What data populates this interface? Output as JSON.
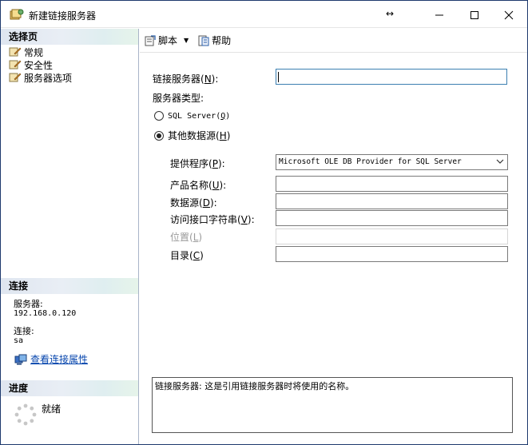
{
  "window": {
    "title": "新建链接服务器",
    "resize_glyph": "↔"
  },
  "left": {
    "select_page_header": "选择页",
    "pages": [
      {
        "label": "常规"
      },
      {
        "label": "安全性"
      },
      {
        "label": "服务器选项"
      }
    ],
    "connection_header": "连接",
    "server_label": "服务器:",
    "server_value": "192.168.0.120",
    "connection_label": "连接:",
    "connection_value": "sa",
    "view_props_link": "查看连接属性",
    "progress_header": "进度",
    "progress_status": "就绪"
  },
  "toolbar": {
    "script_label": "脚本",
    "help_label": "帮助"
  },
  "form": {
    "linked_server_label": "链接服务器(",
    "linked_server_key": "N",
    "linked_server_suffix": "):",
    "linked_server_value": "",
    "server_type_label": "服务器类型:",
    "sql_server_option": "SQL Server(",
    "sql_server_key": "Q",
    "sql_server_suffix": ")",
    "other_source_option": "其他数据源(",
    "other_source_key": "H",
    "other_source_suffix": ")",
    "selected_type": "other",
    "provider_label": "提供程序(",
    "provider_key": "P",
    "provider_suffix": "):",
    "provider_value": "Microsoft OLE DB Provider for SQL Server",
    "product_name_label": "产品名称(",
    "product_name_key": "U",
    "product_name_suffix": "):",
    "product_name_value": "",
    "data_source_label": "数据源(",
    "data_source_key": "D",
    "data_source_suffix": "):",
    "data_source_value": "",
    "provider_string_label": "访问接口字符串(",
    "provider_string_key": "V",
    "provider_string_suffix": "):",
    "provider_string_value": "",
    "location_label": "位置(",
    "location_key": "L",
    "location_suffix": ")",
    "location_value": "",
    "catalog_label": "目录(",
    "catalog_key": "C",
    "catalog_suffix": ")",
    "catalog_value": "",
    "description": "链接服务器: 这是引用链接服务器时将使用的名称。"
  },
  "colors": {
    "accent": "#3c7fb1",
    "link": "#0645ad",
    "frame": "#1e3a6d"
  },
  "icons": [
    "app-icon",
    "minimize-icon",
    "maximize-icon",
    "close-icon",
    "page-icon",
    "script-icon",
    "help-icon",
    "connection-properties-icon",
    "spinner-icon",
    "chevron-down-icon"
  ]
}
